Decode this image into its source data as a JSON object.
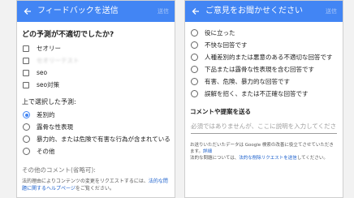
{
  "left": {
    "header_title": "フィードバックを送信",
    "send_label": "送信",
    "question": "どの予測が不適切でしたか?",
    "predictions": [
      "セオリー",
      "セオリーテスト",
      "seo",
      "seo対策"
    ],
    "section_label": "上で選択した予測:",
    "options": [
      {
        "label": "差別的",
        "selected": true
      },
      {
        "label": "露骨な性表現",
        "selected": false
      },
      {
        "label": "暴力的、または危険で有害な行為が含まれている",
        "selected": false
      },
      {
        "label": "その他",
        "selected": false
      }
    ],
    "comment_label": "その他のコメント(省略可):",
    "note_text": "法的理由によりコンテンツの変更をリクエストするには、",
    "note_link": "法的な問題に関するヘルプページ",
    "note_suffix": "をご覧ください。"
  },
  "right": {
    "header_title": "ご意見をお聞かせください",
    "send_label": "送信",
    "options": [
      "役に立った",
      "不快な回答です",
      "人種差別的または悪意のある不適切な回答です",
      "下品または露骨な性表現を含む回答です",
      "有害、危険、暴力的な回答です",
      "誤解を招く、または不正確な回答です"
    ],
    "comment_section": "コメントや提案を送る",
    "input_placeholder": "必須ではありませんが、ここに説明を入力してください",
    "footer_text": "お送りいただいたデータは Google 検索の改善に役立てさせていただきます。",
    "footer_link1": "詳細",
    "footer_text2": "法的な問題については、",
    "footer_link2": "法的な削除リクエストを送信",
    "footer_suffix": "してください。"
  },
  "colors": {
    "header": "#4285f4",
    "link": "#1a5fcc",
    "selected": "#4285f4"
  }
}
